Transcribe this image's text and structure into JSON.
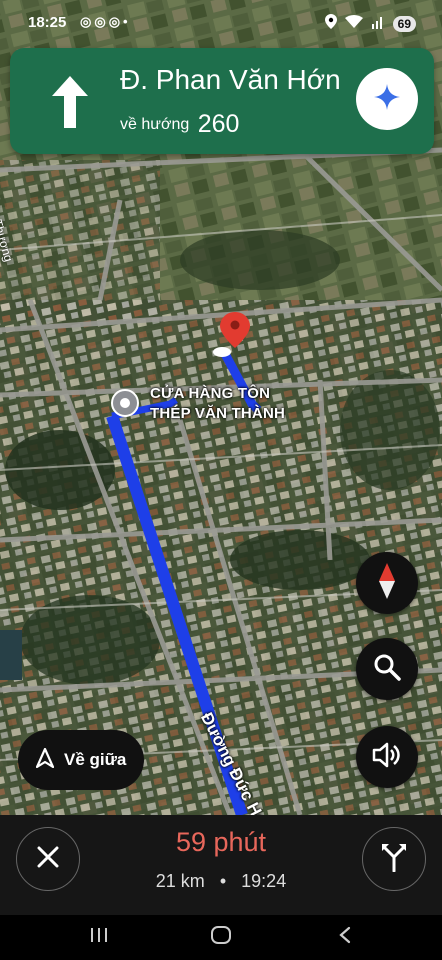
{
  "status_bar": {
    "time": "18:25",
    "notification_icons": [
      "messenger-icon",
      "messenger-icon",
      "messenger-icon"
    ],
    "notification_dot": "•",
    "battery": "69"
  },
  "direction": {
    "maneuver": "straight-arrow-icon",
    "street": "Đ. Phan Văn Hớn",
    "toward_label": "về hướng",
    "toward_number": "260"
  },
  "map": {
    "place_label_line1": "CỬA HÀNG TÔN",
    "place_label_line2": "THÉP VĂN THÀNH",
    "street_main": "Đường Đức Hoà Thượng",
    "street_left": "Hà Thương",
    "route_color": "#2244ee"
  },
  "controls": {
    "recenter_label": "Về giữa"
  },
  "trip": {
    "minutes": "59",
    "minutes_unit": "phút",
    "distance": "21 km",
    "separator": "•",
    "eta": "19:24"
  },
  "colors": {
    "direction_bg": "#1e6f4c",
    "eta_accent": "#e8675b"
  }
}
